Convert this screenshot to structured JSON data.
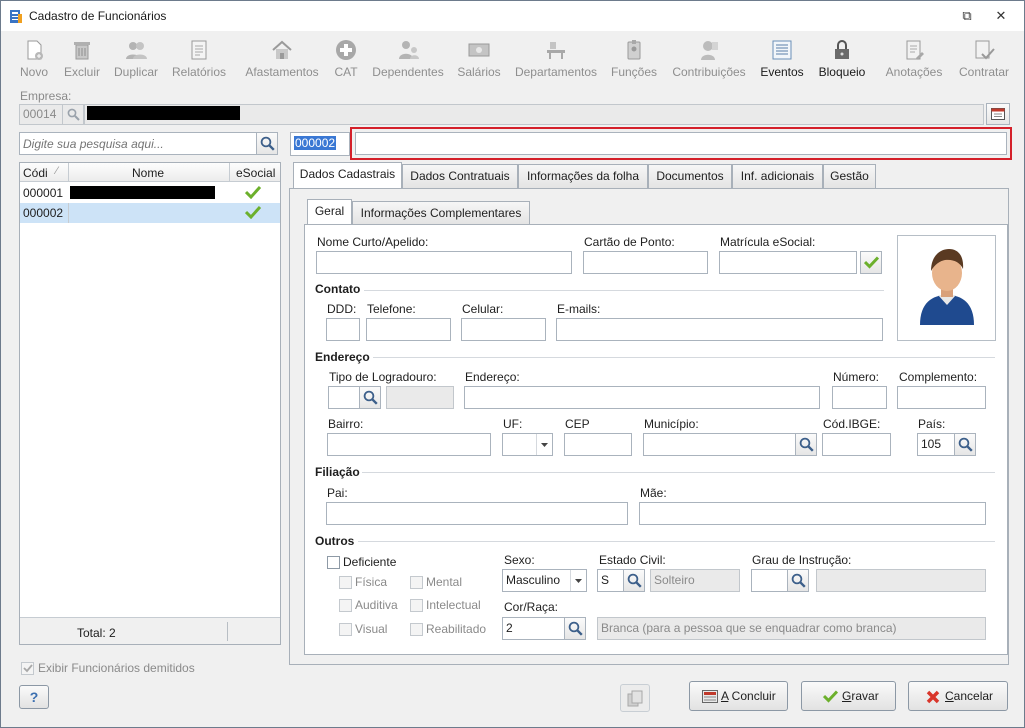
{
  "window": {
    "title": "Cadastro de Funcionários"
  },
  "toolbar": {
    "items": [
      {
        "label": "Novo",
        "icon": "new-icon",
        "enabled": false
      },
      {
        "label": "Excluir",
        "icon": "trash-icon",
        "enabled": false
      },
      {
        "label": "Duplicar",
        "icon": "users-icon",
        "enabled": false
      },
      {
        "label": "Relatórios",
        "icon": "report-icon",
        "enabled": false
      },
      {
        "label": "Afastamentos",
        "icon": "house-icon",
        "enabled": false
      },
      {
        "label": "CAT",
        "icon": "cross-icon",
        "enabled": false
      },
      {
        "label": "Dependentes",
        "icon": "dependents-icon",
        "enabled": false
      },
      {
        "label": "Salários",
        "icon": "money-icon",
        "enabled": false
      },
      {
        "label": "Departamentos",
        "icon": "department-icon",
        "enabled": false
      },
      {
        "label": "Funções",
        "icon": "badge-icon",
        "enabled": false
      },
      {
        "label": "Contribuições",
        "icon": "contrib-icon",
        "enabled": false
      },
      {
        "label": "Eventos",
        "icon": "list-icon",
        "enabled": true
      },
      {
        "label": "Bloqueio",
        "icon": "lock-icon",
        "enabled": true
      },
      {
        "label": "Anotações",
        "icon": "notes-icon",
        "enabled": false
      },
      {
        "label": "Contratar",
        "icon": "hire-icon",
        "enabled": false
      }
    ]
  },
  "empresa": {
    "label": "Empresa:",
    "code": "00014"
  },
  "search": {
    "placeholder": "Digite sua pesquisa aqui..."
  },
  "current": {
    "code": "000002",
    "name": ""
  },
  "employees": {
    "headers": {
      "code": "Códi",
      "name": "Nome",
      "esocial": "eSocial"
    },
    "rows": [
      {
        "code": "000001"
      },
      {
        "code": "000002"
      }
    ],
    "total": "Total: 2"
  },
  "show_fired": {
    "label": "Exibir Funcionários demitidos"
  },
  "help": {
    "label": "?"
  },
  "main_tabs": [
    "Dados Cadastrais",
    "Dados Contratuais",
    "Informações da folha",
    "Documentos",
    "Inf. adicionais",
    "Gestão"
  ],
  "sub_tabs": [
    "Geral",
    "Informações Complementares"
  ],
  "form": {
    "nome_curto": "Nome Curto/Apelido:",
    "cartao": "Cartão de Ponto:",
    "matricula": "Matrícula eSocial:",
    "contato": "Contato",
    "ddd": "DDD:",
    "telefone": "Telefone:",
    "celular": "Celular:",
    "emails": "E-mails:",
    "endereco_grp": "Endereço",
    "tipo_logradouro": "Tipo de Logradouro:",
    "endereco": "Endereço:",
    "numero": "Número:",
    "complemento": "Complemento:",
    "bairro": "Bairro:",
    "uf": "UF:",
    "cep": "CEP",
    "municipio": "Município:",
    "cod_ibge": "Cód.IBGE:",
    "pais": "País:",
    "pais_value": "105",
    "filiacao": "Filiação",
    "pai": "Pai:",
    "mae": "Mãe:",
    "outros": "Outros",
    "deficiente": "Deficiente",
    "deficiencias": [
      "Física",
      "Mental",
      "Auditiva",
      "Intelectual",
      "Visual",
      "Reabilitado"
    ],
    "sexo": "Sexo:",
    "sexo_value": "Masculino",
    "estado_civil": "Estado Civil:",
    "estado_civil_code": "S",
    "estado_civil_desc": "Solteiro",
    "grau_instrucao": "Grau de Instrução:",
    "cor_raca": "Cor/Raça:",
    "cor_raca_code": "2",
    "cor_raca_desc": "Branca (para a pessoa que se enquadrar como branca)"
  },
  "buttons": {
    "concluir_a": "A",
    "concluir": " Concluir",
    "gravar_g": "G",
    "gravar": "ravar",
    "cancelar_c": "C",
    "cancelar": "ancelar"
  }
}
